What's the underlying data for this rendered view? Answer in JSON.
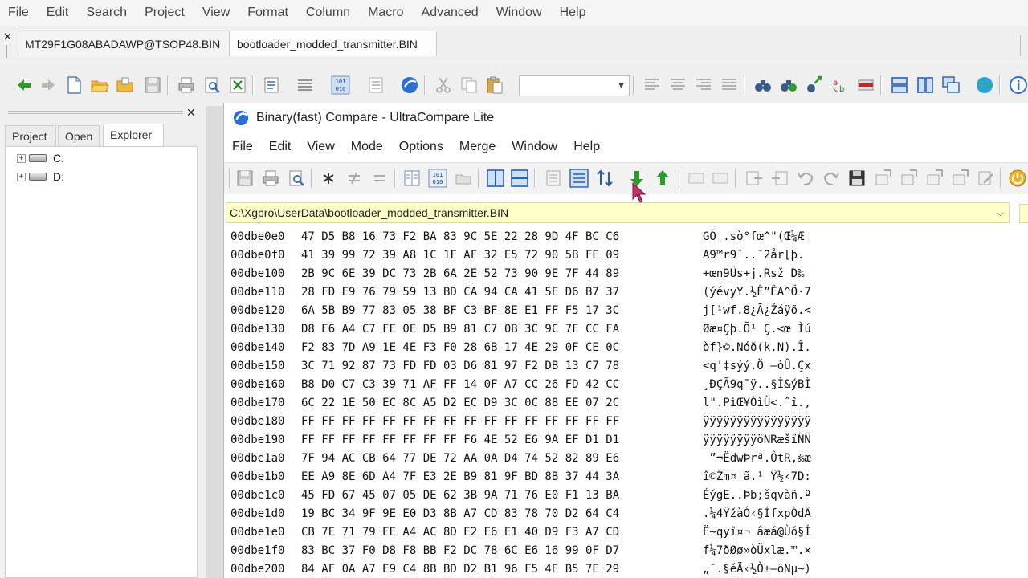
{
  "app": {
    "menu": [
      "File",
      "Edit",
      "Search",
      "Project",
      "View",
      "Format",
      "Column",
      "Macro",
      "Advanced",
      "Window",
      "Help"
    ],
    "tabs": [
      {
        "label": "MT29F1G08ABADAWP@TSOP48.BIN"
      },
      {
        "label": "bootloader_modded_transmitter.BIN"
      }
    ],
    "toolbar_combo_value": ""
  },
  "left_panel": {
    "tabs": [
      "Project",
      "Open",
      "Explorer"
    ],
    "active_tab": "Explorer",
    "tree": [
      {
        "label": "C:"
      },
      {
        "label": "D:"
      }
    ]
  },
  "compare": {
    "title": "Binary(fast) Compare - UltraCompare Lite",
    "menu": [
      "File",
      "Edit",
      "View",
      "Mode",
      "Options",
      "Merge",
      "Window",
      "Help"
    ],
    "path": "C:\\Xgpro\\UserData\\bootloader_modded_transmitter.BIN",
    "rows": [
      {
        "addr": "00dbe0e0",
        "hex": "47 D5 B8 16 73 F2 BA 83 9C 5E 22 28 9D 4F BC C6",
        "ascii": "GÕ¸.sò°fœ^\"(Œ¼Æ"
      },
      {
        "addr": "00dbe0f0",
        "hex": "41 39 99 72 39 A8 1C 1F AF 32 E5 72 90 5B FE 09",
        "ascii": "A9™r9¨..¯2år[þ."
      },
      {
        "addr": "00dbe100",
        "hex": "2B 9C 6E 39 DC 73 2B 6A 2E 52 73 90 9E 7F 44 89",
        "ascii": "+œn9Üs+j.Rsž D‰"
      },
      {
        "addr": "00dbe110",
        "hex": "28 FD E9 76 79 59 13 BD CA 94 CA 41 5E D6 B7 37",
        "ascii": "(ýévyY.½Ê”ÊA^Ö·7"
      },
      {
        "addr": "00dbe120",
        "hex": "6A 5B B9 77 83 05 38 BF C3 BF 8E E1 FF F5 17 3C",
        "ascii": "j[¹wf.8¿Ã¿Žáÿõ.<"
      },
      {
        "addr": "00dbe130",
        "hex": "D8 E6 A4 C7 FE 0E D5 B9 81 C7 0B 3C 9C 7F CC FA",
        "ascii": "Øæ¤Çþ.Õ¹ Ç.<œ Ìú"
      },
      {
        "addr": "00dbe140",
        "hex": "F2 83 7D A9 1E 4E F3 F0 28 6B 17 4E 29 0F CE 0C",
        "ascii": "òf}©.Nóð(k.N).Î."
      },
      {
        "addr": "00dbe150",
        "hex": "3C 71 92 87 73 FD FD 03 D6 81 97 F2 DB 13 C7 78",
        "ascii": "<q'‡sýý.Ö —òÛ.Çx"
      },
      {
        "addr": "00dbe160",
        "hex": "B8 D0 C7 C3 39 71 AF FF 14 0F A7 CC 26 FD 42 CC",
        "ascii": "¸ÐÇÃ9q¯ÿ..§Ì&ýBÌ"
      },
      {
        "addr": "00dbe170",
        "hex": "6C 22 1E 50 EC 8C A5 D2 EC D9 3C 0C 88 EE 07 2C",
        "ascii": "l\".PìŒ¥ÒìÙ<.ˆî.,"
      },
      {
        "addr": "00dbe180",
        "hex": "FF FF FF FF FF FF FF FF FF FF FF FF FF FF FF FF",
        "ascii": "ÿÿÿÿÿÿÿÿÿÿÿÿÿÿÿÿ"
      },
      {
        "addr": "00dbe190",
        "hex": "FF FF FF FF FF FF FF FF F6 4E 52 E6 9A EF D1 D1",
        "ascii": "ÿÿÿÿÿÿÿÿöNRæšïÑÑ"
      },
      {
        "addr": "00dbe1a0",
        "hex": "7F 94 AC CB 64 77 DE 72 AA 0A D4 74 52 82 89 E6",
        "ascii": " ”¬ËdwÞrª.ÔtR‚‰æ"
      },
      {
        "addr": "00dbe1b0",
        "hex": "EE A9 8E 6D A4 7F E3 2E B9 81 9F BD 8B 37 44 3A",
        "ascii": "î©Žm¤ ã.¹ Ÿ½‹7D:"
      },
      {
        "addr": "00dbe1c0",
        "hex": "45 FD 67 45 07 05 DE 62 3B 9A 71 76 E0 F1 13 BA",
        "ascii": "ÉýgE..Þb;šqvàñ.º"
      },
      {
        "addr": "00dbe1d0",
        "hex": "19 BC 34 9F 9E E0 D3 8B A7 CD 83 78 70 D2 64 C4",
        "ascii": ".¼4ŸžàÓ‹§ÍfxpÒdÄ"
      },
      {
        "addr": "00dbe1e0",
        "hex": "CB 7E 71 79 EE A4 AC 8D E2 E6 E1 40 D9 F3 A7 CD",
        "ascii": "Ë~qyî¤¬ âæá@Ùó§Í"
      },
      {
        "addr": "00dbe1f0",
        "hex": "83 BC 37 F0 D8 F8 BB F2 DC 78 6C E6 16 99 0F D7",
        "ascii": "f¼7ðØø»òÜxlæ.™.×"
      },
      {
        "addr": "00dbe200",
        "hex": "84 AF 0A A7 E9 C4 8B BD D2 B1 96 F5 4E B5 7E 29",
        "ascii": "„¯.§éÄ‹½Ò±–õNµ~)"
      }
    ]
  }
}
